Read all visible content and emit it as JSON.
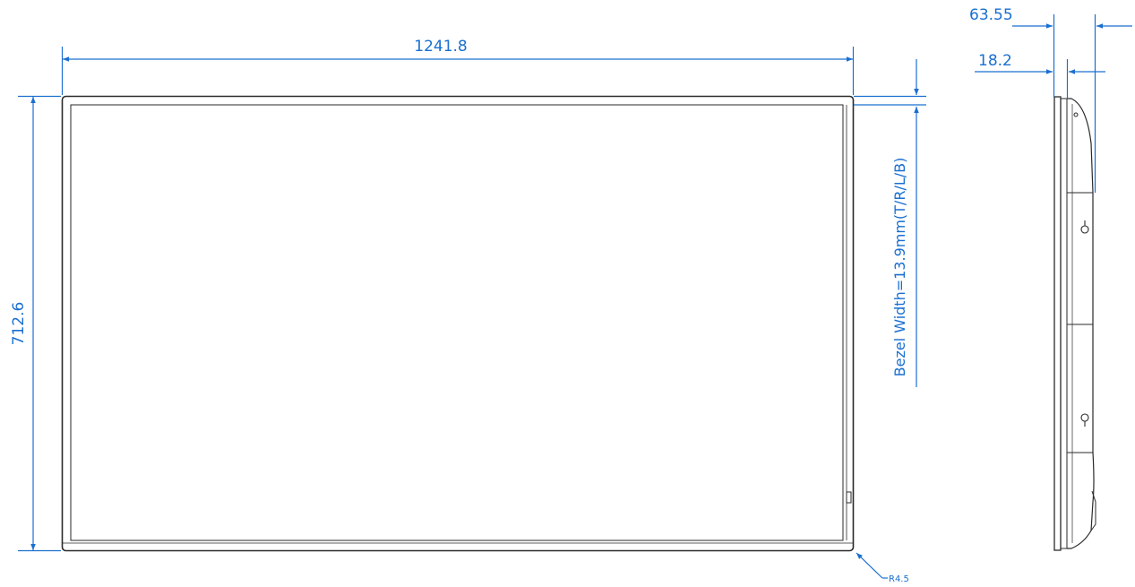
{
  "dimensions": {
    "width": "1241.8",
    "height": "712.6",
    "depth_total": "63.55",
    "depth_panel": "18.2",
    "bezel_note": "Bezel Width=13.9mm(T/R/L/B)",
    "corner_radius": "R4.5"
  },
  "colors": {
    "dimension": "#1a6fd0",
    "outline": "#2a2a2a"
  }
}
